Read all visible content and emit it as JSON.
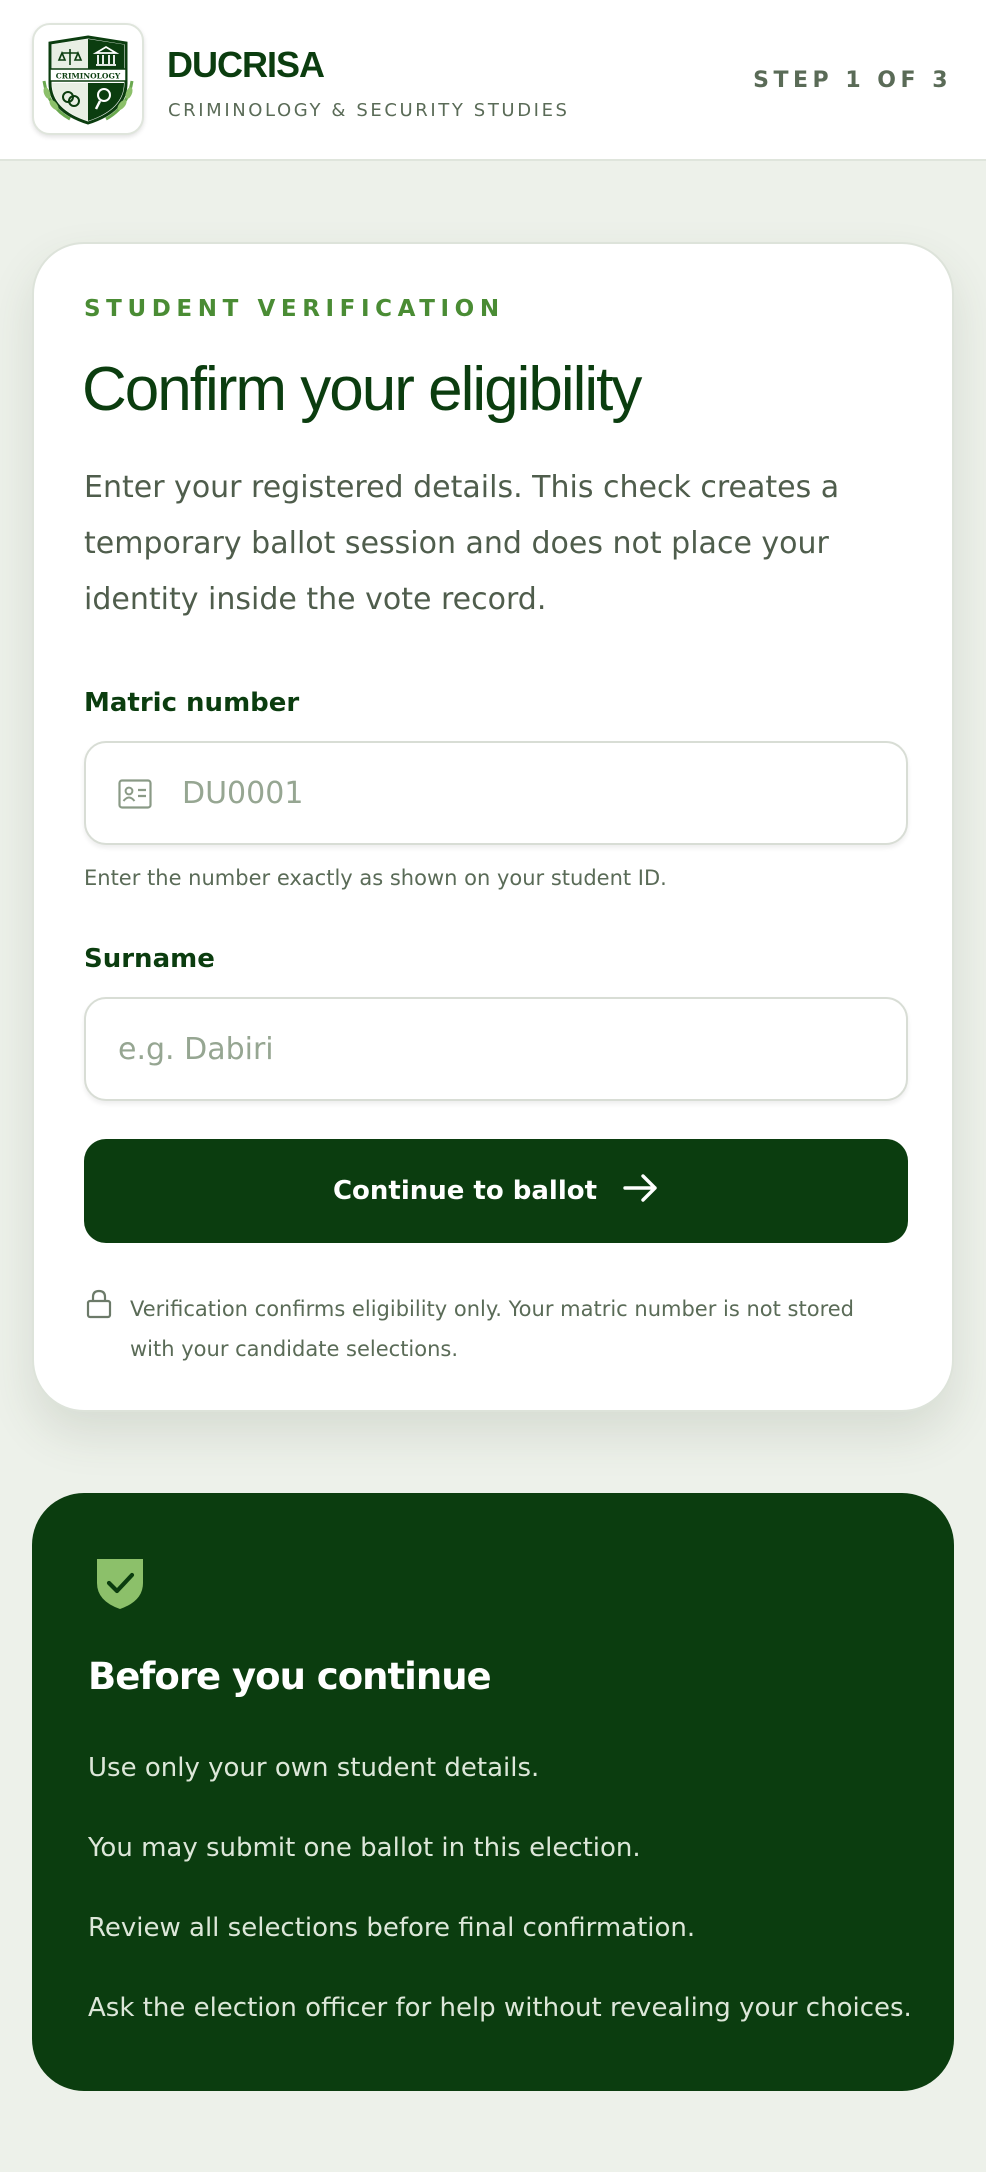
{
  "header": {
    "brand": "DUCRISA",
    "subtitle": "CRIMINOLOGY & SECURITY STUDIES",
    "step": "STEP 1 OF 3",
    "logo_text": "CRIMINOLOGY"
  },
  "form": {
    "eyebrow": "STUDENT VERIFICATION",
    "title": "Confirm your eligibility",
    "description": "Enter your registered details. This check creates a temporary ballot session and does not place your identity inside the vote record.",
    "matric": {
      "label": "Matric number",
      "placeholder": "DU0001",
      "value": "",
      "hint": "Enter the number exactly as shown on your student ID.",
      "icon": "id-card-icon"
    },
    "surname": {
      "label": "Surname",
      "placeholder": "e.g. Dabiri",
      "value": ""
    },
    "submit_label": "Continue to ballot",
    "submit_icon": "arrow-right-icon",
    "privacy_note": "Verification confirms eligibility only. Your matric number is not stored with your candidate selections.",
    "privacy_icon": "lock-icon"
  },
  "info_panel": {
    "icon": "shield-check-icon",
    "title": "Before you continue",
    "items": [
      "Use only your own student details.",
      "You may submit one ballot in this election.",
      "Review all selections before final confirmation.",
      "Ask the election officer for help without revealing your choices."
    ]
  },
  "colors": {
    "brand_dark": "#0b3d0f",
    "accent": "#4a8c34",
    "page_bg": "#edf1ea",
    "shield": "#8cc06a"
  }
}
